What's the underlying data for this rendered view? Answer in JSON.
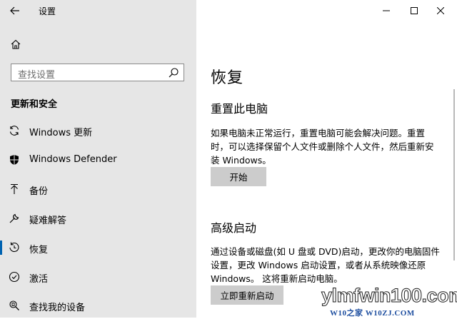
{
  "window": {
    "app_title": "设置",
    "controls": [
      "minimize",
      "maximize",
      "close"
    ]
  },
  "sidebar": {
    "search_placeholder": "查找设置",
    "section_title": "更新和安全",
    "selected": "恢复",
    "items": [
      {
        "label": "Windows 更新",
        "icon": "sync-icon"
      },
      {
        "label": "Windows Defender",
        "icon": "shield-icon"
      },
      {
        "label": "备份",
        "icon": "backup-arrow-icon"
      },
      {
        "label": "疑难解答",
        "icon": "wrench-icon"
      },
      {
        "label": "恢复",
        "icon": "recovery-icon"
      },
      {
        "label": "激活",
        "icon": "check-circle-icon"
      },
      {
        "label": "查找我的设备",
        "icon": "find-device-icon"
      }
    ]
  },
  "main": {
    "title": "恢复",
    "reset": {
      "heading": "重置此电脑",
      "description_lines": [
        "如果电脑未正常运行，重置电脑可能会解决问题。重置",
        "时，可以选择保留个人文件或删除个人文件，然后重新安",
        "装 Windows。"
      ],
      "button": "开始"
    },
    "advanced": {
      "heading": "高级启动",
      "description_lines": [
        "通过设备或磁盘(如 U 盘或 DVD)启动，更改你的电脑固件",
        "设置，更改 Windows 启动设置，或者从系统映像还原",
        "Windows。  这将重新启动电脑。"
      ],
      "button": "立即重新启动"
    }
  },
  "watermark": {
    "main": "ylmfwin100.com",
    "sub": "W10之家 W10ZJ.COM"
  },
  "colors": {
    "sidebar_bg": "#e6e6e6",
    "accent": "#0063b1",
    "button_bg": "#cccccc"
  }
}
